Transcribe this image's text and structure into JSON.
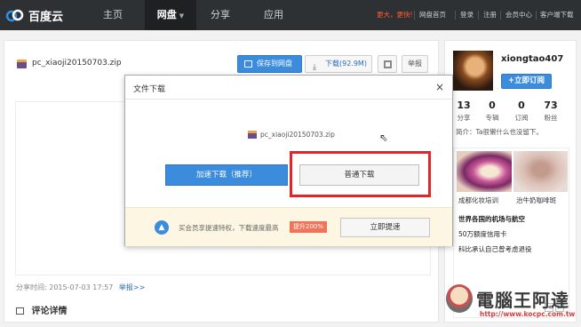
{
  "nav": {
    "logo": "百度云",
    "items": [
      "主页",
      "网盘",
      "分享",
      "应用"
    ],
    "links": [
      "更大，更快!",
      "网盘首页",
      "登录",
      "注册",
      "会员中心",
      "客户端下载"
    ]
  },
  "file": {
    "name": "pc_xiaoji20150703.zip",
    "save_label": "保存到网盘",
    "download_label": "下载(92.9M)",
    "report_label": "举报",
    "share_time": "分享时间: 2015-07-03 17:57",
    "report_link": "举报>>",
    "comments_title": "评论详情"
  },
  "sidebar": {
    "username": "xiongtao407",
    "follow_label": "+立即订阅",
    "stats": [
      {
        "num": "13",
        "label": "分享"
      },
      {
        "num": "0",
        "label": "专辑"
      },
      {
        "num": "0",
        "label": "订阅"
      },
      {
        "num": "73",
        "label": "粉丝"
      }
    ],
    "bio": "简介：Ta很懒什么也没留下。",
    "ads": {
      "cap1": "成都化妆培训",
      "cap2": "治牛奶咖啡斑",
      "line1": "世界各国的机场与航空",
      "line2": "50万额度信用卡",
      "line3": "科比承认自己曾考虑退役"
    }
  },
  "dialog": {
    "title": "文件下载",
    "file_name": "pc_xiaoji20150703.zip",
    "fast_label": "加速下载（推荐）",
    "normal_label": "普通下载",
    "vip_text": "买会员享提速特权，下载速度最高",
    "vip_badge": "提升200%",
    "speed_label": "立即提速"
  },
  "watermark": {
    "text": "電腦王阿達",
    "url": "http://www.kocpc.com.tw"
  },
  "colors": {
    "topbar": "#2e3134",
    "primary": "#3b8cdc",
    "highlight": "#e0262a",
    "promo": "#ff5a32"
  }
}
